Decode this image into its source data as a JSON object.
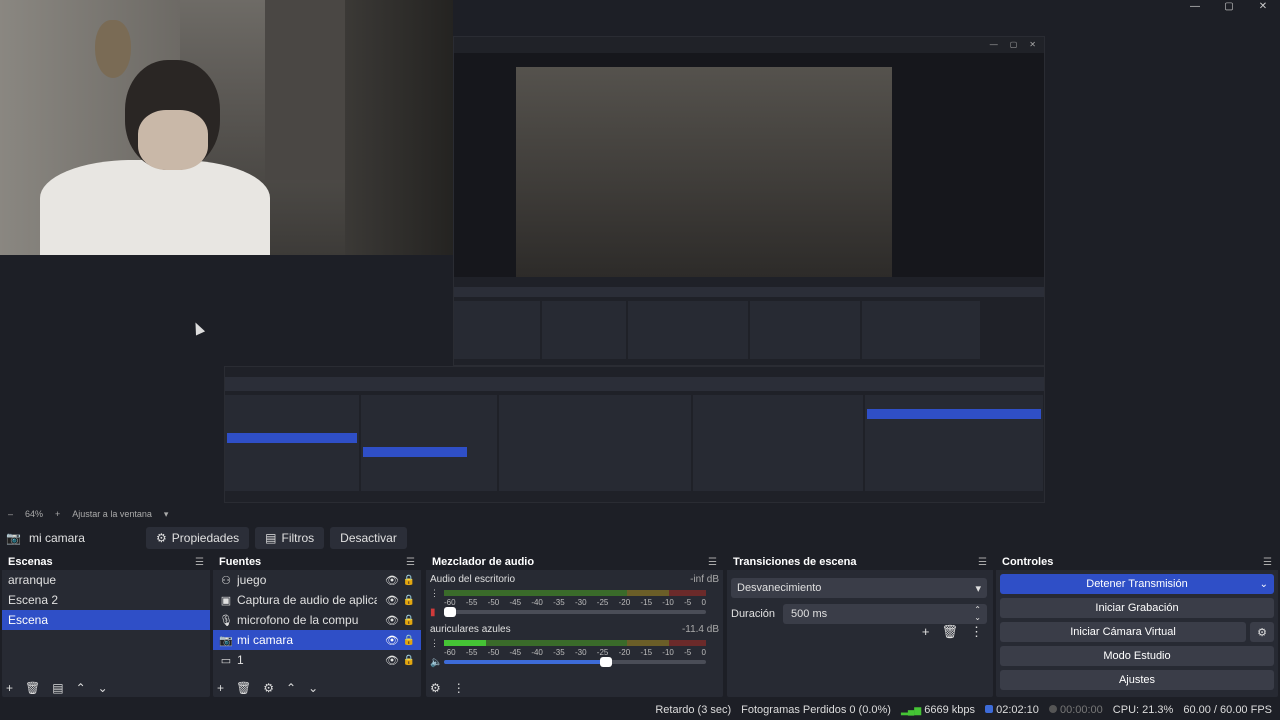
{
  "window": {
    "controls": [
      "—",
      "▢",
      "✕"
    ]
  },
  "zoom": {
    "minus": "–",
    "value": "64%",
    "plus": "+",
    "fit_label": "Ajustar a la ventana"
  },
  "source_bar": {
    "source_name": "mi camara",
    "properties_label": "Propiedades",
    "filters_label": "Filtros",
    "deactivate_label": "Desactivar"
  },
  "scenes": {
    "title": "Escenas",
    "items": [
      {
        "label": "arranque",
        "selected": false
      },
      {
        "label": "Escena 2",
        "selected": false
      },
      {
        "label": "Escena",
        "selected": true
      }
    ]
  },
  "sources": {
    "title": "Fuentes",
    "items": [
      {
        "icon": "gamepad-icon",
        "glyph": "⚇",
        "label": "juego",
        "selected": false
      },
      {
        "icon": "audio-capture-icon",
        "glyph": "▣",
        "label": "Captura de audio de aplicación (BET",
        "selected": false
      },
      {
        "icon": "microphone-icon",
        "glyph": "🎙",
        "label": "microfono de la compu",
        "selected": false
      },
      {
        "icon": "camera-icon",
        "glyph": "📷",
        "label": "mi camara",
        "selected": true
      },
      {
        "icon": "display-icon",
        "glyph": "▭",
        "label": "1",
        "selected": false
      }
    ]
  },
  "mixer": {
    "title": "Mezclador de audio",
    "channels": [
      {
        "name": "Audio del escritorio",
        "db": "-inf dB",
        "level": 0.0,
        "fader": 0.02
      },
      {
        "name": "auriculares azules",
        "db": "-11.4 dB",
        "level": 0.16,
        "fader": 0.62
      }
    ],
    "ticks": [
      "-60",
      "-55",
      "-50",
      "-45",
      "-40",
      "-35",
      "-30",
      "-25",
      "-20",
      "-15",
      "-10",
      "-5",
      "0"
    ]
  },
  "transitions": {
    "title": "Transiciones de escena",
    "selected": "Desvanecimiento",
    "duration_label": "Duración",
    "duration_value": "500 ms"
  },
  "controls": {
    "title": "Controles",
    "stop_stream": "Detener Transmisión",
    "start_record": "Iniciar Grabación",
    "start_virtualcam": "Iniciar Cámara Virtual",
    "studio_mode": "Modo Estudio",
    "settings": "Ajustes"
  },
  "status": {
    "delay": "Retardo (3 sec)",
    "dropped": "Fotogramas Perdidos 0 (0.0%)",
    "bitrate": "6669 kbps",
    "stream_time": "02:02:10",
    "record_time": "00:00:00",
    "cpu": "CPU: 21.3%",
    "fps": "60.00 / 60.00 FPS"
  },
  "colors": {
    "accent": "#2f4fc7",
    "panel": "#272a33",
    "background": "#1d1f26",
    "meter_green": "#45c435"
  }
}
